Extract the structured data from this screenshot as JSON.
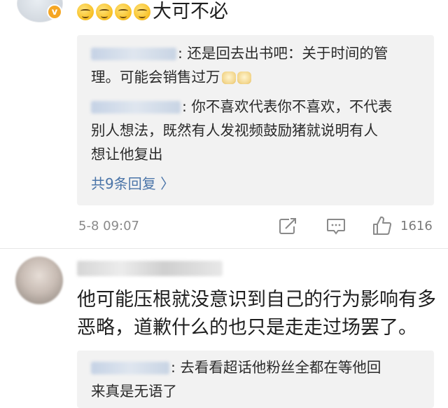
{
  "top_comment": {
    "text": "大可不必",
    "emoji_icon": "grinning-face-emoji"
  },
  "reply_box_1": {
    "reply_1": {
      "text_part_1": ": 还是回去出书吧：关于时间的管",
      "text_part_2": "理。可能会销售过万"
    },
    "reply_2": {
      "text_line_1": ": 你不喜欢代表你不喜欢，不代表",
      "text_line_2": "别人想法，既然有人发视频鼓励猪就说明有人",
      "text_line_3": "想让他复出"
    },
    "more_replies": "共9条回复 〉"
  },
  "meta": {
    "timestamp": "5-8 09:07",
    "like_count": "1616",
    "icons": [
      "share-icon",
      "comment-icon",
      "like-icon"
    ]
  },
  "second_comment": {
    "text_line_1": "他可能压根就没意识到自己的行为影响有多",
    "text_line_2": "恶略，道歉什么的也只是走走过场罢了。",
    "reply": {
      "text_line_1": ": 去看看超话他粉丝全都在等他回",
      "text_line_2": "来真是无语了"
    }
  },
  "colors": {
    "link_blue": "#4a74a8",
    "reply_bg": "#f2f2f2",
    "meta_gray": "#8a8a8a",
    "verified": "#f5a623"
  }
}
